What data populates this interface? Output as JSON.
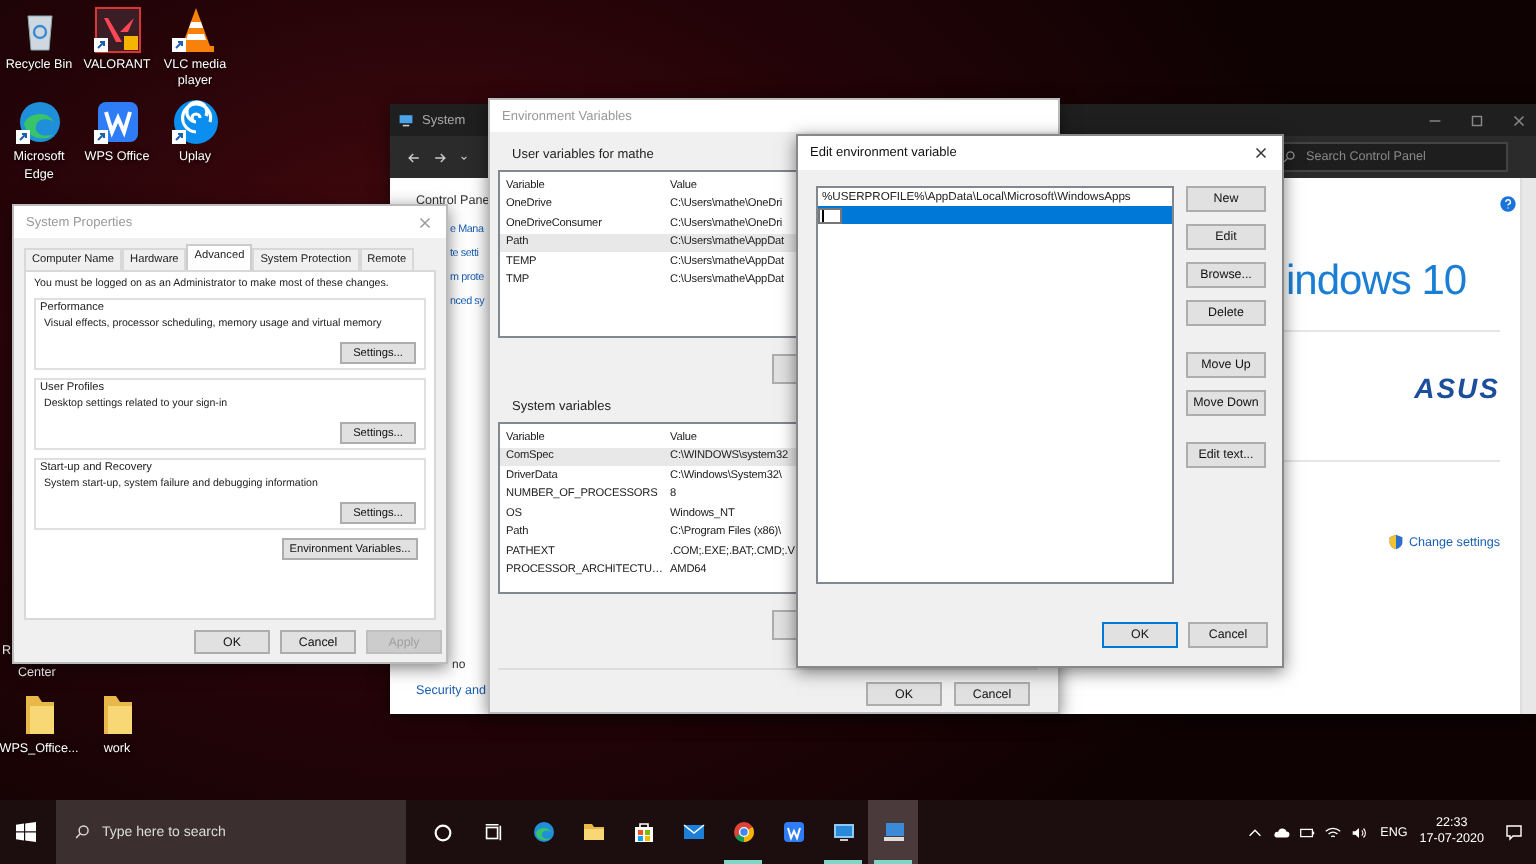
{
  "desktop_icons": [
    {
      "kind": "recycle",
      "label": "Recycle Bin"
    },
    {
      "kind": "valorant",
      "label": "VALORANT"
    },
    {
      "kind": "cone",
      "label": "VLC media player"
    },
    {
      "kind": "edge",
      "label": "Microsoft Edge"
    },
    {
      "kind": "wps",
      "label": "WPS Office"
    },
    {
      "kind": "swirl",
      "label": "Uplay"
    }
  ],
  "covered_icon": {
    "label_start": "R",
    "label_end": "Center"
  },
  "folders": [
    {
      "label": "WPS_Office..."
    },
    {
      "label": "work"
    }
  ],
  "system_window": {
    "title": "System",
    "search_placeholder": "Search Control Panel",
    "breadcrumb": "Control Pane",
    "nav_links": [
      "e Mana",
      "te setti",
      "m prote",
      "nced sy"
    ],
    "footer_links": [
      "no",
      "Security and"
    ],
    "windows_logo": "indows 10",
    "brand": "ASUS",
    "change_settings": "Change settings"
  },
  "system_properties": {
    "title": "System Properties",
    "tabs": [
      {
        "label": "Computer Name",
        "selected": false
      },
      {
        "label": "Hardware",
        "selected": false
      },
      {
        "label": "Advanced",
        "selected": true
      },
      {
        "label": "System Protection",
        "selected": false
      },
      {
        "label": "Remote",
        "selected": false
      }
    ],
    "notice": "You must be logged on as an Administrator to make most of these changes.",
    "groups": [
      {
        "title": "Performance",
        "description": "Visual effects, processor scheduling, memory usage and virtual memory",
        "button": "Settings..."
      },
      {
        "title": "User Profiles",
        "description": "Desktop settings related to your sign-in",
        "button": "Settings..."
      },
      {
        "title": "Start-up and Recovery",
        "description": "System start-up, system failure and debugging information",
        "button": "Settings..."
      }
    ],
    "env_button": "Environment Variables...",
    "buttons": [
      {
        "label": "OK",
        "disabled": false
      },
      {
        "label": "Cancel",
        "disabled": false
      },
      {
        "label": "Apply",
        "disabled": true
      }
    ]
  },
  "environment_variables": {
    "title": "Environment Variables",
    "user_heading": "User variables for mathe",
    "user_table": {
      "columns": [
        "Variable",
        "Value"
      ],
      "rows": [
        {
          "variable": "OneDrive",
          "value": "C:\\Users\\mathe\\OneDri",
          "selected": false
        },
        {
          "variable": "OneDriveConsumer",
          "value": "C:\\Users\\mathe\\OneDri",
          "selected": false
        },
        {
          "variable": "Path",
          "value": "C:\\Users\\mathe\\AppDat",
          "selected": true
        },
        {
          "variable": "TEMP",
          "value": "C:\\Users\\mathe\\AppDat",
          "selected": false
        },
        {
          "variable": "TMP",
          "value": "C:\\Users\\mathe\\AppDat",
          "selected": false
        }
      ]
    },
    "system_heading": "System variables",
    "system_table": {
      "columns": [
        "Variable",
        "Value"
      ],
      "rows": [
        {
          "variable": "ComSpec",
          "value": "C:\\WINDOWS\\system32",
          "selected": true
        },
        {
          "variable": "DriverData",
          "value": "C:\\Windows\\System32\\",
          "selected": false
        },
        {
          "variable": "NUMBER_OF_PROCESSORS",
          "value": "8",
          "selected": false
        },
        {
          "variable": "OS",
          "value": "Windows_NT",
          "selected": false
        },
        {
          "variable": "Path",
          "value": "C:\\Program Files (x86)\\",
          "selected": false
        },
        {
          "variable": "PATHEXT",
          "value": ".COM;.EXE;.BAT;.CMD;.V",
          "selected": false
        },
        {
          "variable": "PROCESSOR_ARCHITECTU…",
          "value": "AMD64",
          "selected": false
        }
      ]
    },
    "buttons": [
      "OK",
      "Cancel"
    ]
  },
  "edit_variable": {
    "title": "Edit environment variable",
    "entries": [
      {
        "text": "%USERPROFILE%\\AppData\\Local\\Microsoft\\WindowsApps",
        "selected": false,
        "editing": false
      },
      {
        "selected": true,
        "editing": true
      }
    ],
    "side_buttons": [
      [
        "New",
        "Edit",
        "Browse...",
        "Delete"
      ],
      [
        "Move Up",
        "Move Down"
      ],
      [
        "Edit text..."
      ]
    ],
    "buttons": [
      {
        "label": "OK",
        "default": true
      },
      {
        "label": "Cancel",
        "default": false
      }
    ]
  },
  "taskbar": {
    "search_placeholder": "Type here to search",
    "apps": [
      {
        "kind": "edge",
        "running": false,
        "selected": false
      },
      {
        "kind": "folder",
        "running": false,
        "selected": false
      },
      {
        "kind": "store",
        "running": false,
        "selected": false
      },
      {
        "kind": "mail",
        "running": false,
        "selected": false
      },
      {
        "kind": "chrome",
        "running": true,
        "selected": false
      },
      {
        "kind": "wps",
        "running": false,
        "selected": false
      },
      {
        "kind": "monitor",
        "running": true,
        "selected": false
      },
      {
        "kind": "system",
        "running": true,
        "selected": true
      }
    ],
    "language": "ENG",
    "time": "22:33",
    "date": "17-07-2020"
  }
}
